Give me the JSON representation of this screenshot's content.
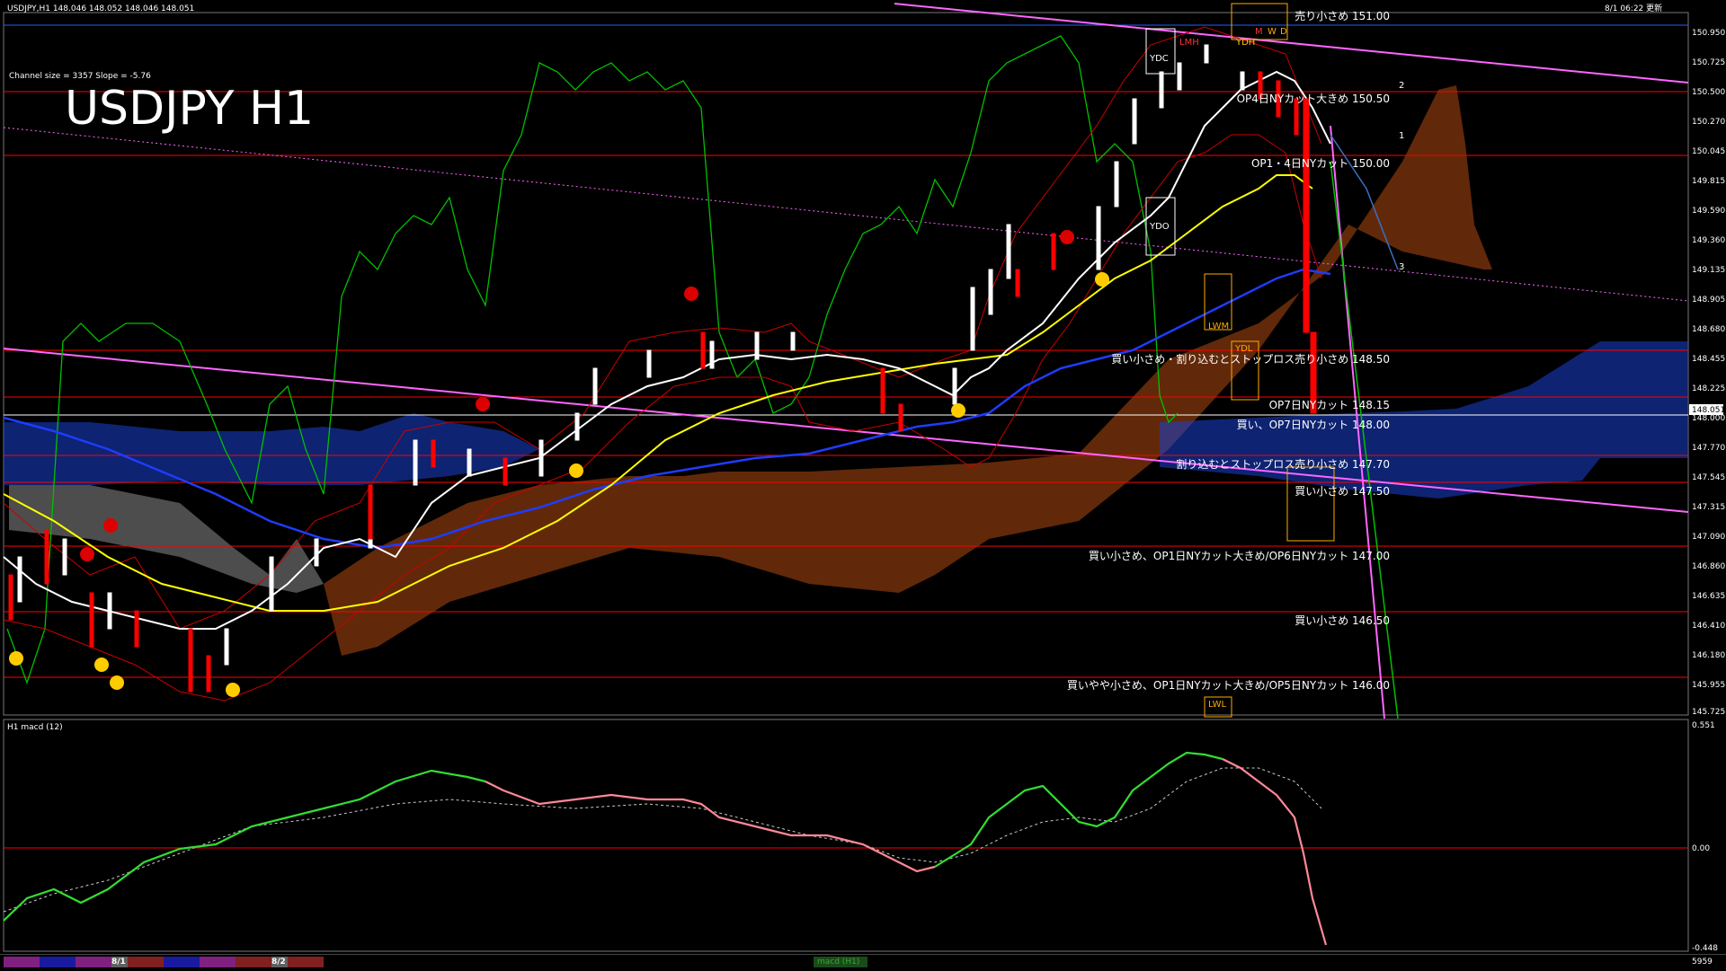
{
  "header": {
    "symbol_info": "USDJPY,H1  148.046 148.052 148.046 148.051",
    "channel_info": "Channel size = 3357 Slope = -5.76",
    "timestamp": "8/1 06:22 更新",
    "big_title": "USDJPY H1"
  },
  "price_axis": {
    "labels": [
      "150.950",
      "150.725",
      "150.500",
      "150.270",
      "150.045",
      "149.815",
      "149.590",
      "149.360",
      "149.135",
      "148.905",
      "148.680",
      "148.455",
      "148.225",
      "148.000",
      "147.770",
      "147.545",
      "147.315",
      "147.090",
      "146.860",
      "146.635",
      "146.410",
      "146.180",
      "145.955",
      "145.725"
    ],
    "current_price": "148.051"
  },
  "levels": [
    {
      "text": "売り小さめ 151.00",
      "color": "#ff0000"
    },
    {
      "text": "OP4日NYカット大きめ 150.50",
      "color": "#ff0000"
    },
    {
      "text": "OP1・4日NYカット 150.00",
      "color": "#ff0000"
    },
    {
      "text": "買い小さめ・割り込むとストップロス売り小さめ 148.50",
      "color": "#ff0000"
    },
    {
      "text": "OP7日NYカット 148.15",
      "color": "#ff0000"
    },
    {
      "text": "買い、OP7日NYカット 148.00",
      "color": "#ff0000"
    },
    {
      "text": "割り込むとストップロス売り小さめ 147.70",
      "color": "#ff0000"
    },
    {
      "text": "買い小さめ 147.50",
      "color": "#ff0000"
    },
    {
      "text": "買い小さめ、OP1日NYカット大きめ/OP6日NYカット 147.00",
      "color": "#ff0000"
    },
    {
      "text": "買い小さめ 146.50",
      "color": "#ff0000"
    },
    {
      "text": "買いやや小さめ、OP1日NYカット大きめ/OP5日NYカット 146.00",
      "color": "#ff0000"
    }
  ],
  "markers": {
    "ydc": "YDC",
    "lmh": "LMH",
    "ydh": "YDH",
    "ydo": "YDO",
    "ydl": "YDL",
    "lwm": "LWM",
    "lwl": "LWL",
    "m": "M",
    "w": "W",
    "d": "D",
    "n1": "1",
    "n2": "2",
    "n3": "3"
  },
  "macd_panel": {
    "title": "H1  macd (12)",
    "axis_top": "0.551",
    "axis_zero": "0.00",
    "axis_bottom": "-0.448"
  },
  "bottom_bar": {
    "tab1": "8/1",
    "tab2": "8/2",
    "indicator": "macd (H1)",
    "right_value": "5959"
  },
  "colors": {
    "background": "#000000",
    "level_line": "#ff0000",
    "ma_white": "#ffffff",
    "ma_yellow": "#ffff00",
    "ma_blue": "#1e3cff",
    "chikou": "#00c000",
    "bollinger": "#cc0000",
    "channel": "#ff66ff",
    "macd_up": "#33dd33",
    "macd_down": "#ff8899"
  }
}
